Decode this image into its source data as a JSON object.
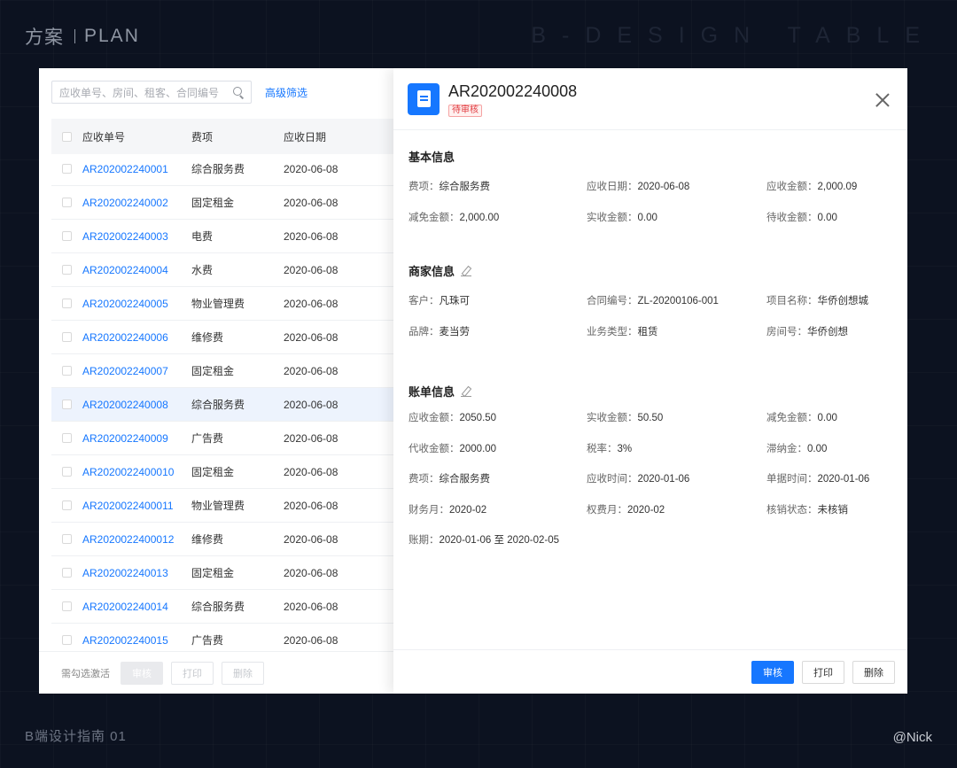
{
  "page": {
    "title_cn": "方案",
    "title_en": "PLAN",
    "brand_right": "B-DESIGN TABLE",
    "footer_left": "B端设计指南 01",
    "footer_right": "@Nick"
  },
  "list": {
    "search_placeholder": "应收单号、房间、租客、合同编号",
    "advanced_filter": "高级筛选",
    "columns": {
      "no": "应收单号",
      "fee": "费项",
      "date": "应收日期"
    },
    "rows": [
      {
        "no": "AR202002240001",
        "fee": "综合服务费",
        "date": "2020-06-08"
      },
      {
        "no": "AR202002240002",
        "fee": "固定租金",
        "date": "2020-06-08"
      },
      {
        "no": "AR202002240003",
        "fee": "电费",
        "date": "2020-06-08"
      },
      {
        "no": "AR202002240004",
        "fee": "水费",
        "date": "2020-06-08"
      },
      {
        "no": "AR202002240005",
        "fee": "物业管理费",
        "date": "2020-06-08"
      },
      {
        "no": "AR202002240006",
        "fee": "维修费",
        "date": "2020-06-08"
      },
      {
        "no": "AR202002240007",
        "fee": "固定租金",
        "date": "2020-06-08"
      },
      {
        "no": "AR202002240008",
        "fee": "综合服务费",
        "date": "2020-06-08"
      },
      {
        "no": "AR202002240009",
        "fee": "广告费",
        "date": "2020-06-08"
      },
      {
        "no": "AR2020022400010",
        "fee": "固定租金",
        "date": "2020-06-08"
      },
      {
        "no": "AR2020022400011",
        "fee": "物业管理费",
        "date": "2020-06-08"
      },
      {
        "no": "AR2020022400012",
        "fee": "维修费",
        "date": "2020-06-08"
      },
      {
        "no": "AR202002240013",
        "fee": "固定租金",
        "date": "2020-06-08"
      },
      {
        "no": "AR202002240014",
        "fee": "综合服务费",
        "date": "2020-06-08"
      },
      {
        "no": "AR202002240015",
        "fee": "广告费",
        "date": "2020-06-08"
      }
    ],
    "selected_index": 7,
    "footer_hint": "需勾选激活",
    "footer_buttons": [
      "审核",
      "打印",
      "删除"
    ]
  },
  "detail": {
    "title": "AR202002240008",
    "status": "待审核",
    "section_basic": "基本信息",
    "section_merchant": "商家信息",
    "section_bill": "账单信息",
    "basic": [
      {
        "label": "费项：",
        "value": "综合服务费"
      },
      {
        "label": "应收日期：",
        "value": "2020-06-08"
      },
      {
        "label": "应收金额：",
        "value": "2,000.09"
      },
      {
        "label": "减免金额：",
        "value": "2,000.00"
      },
      {
        "label": "实收金额：",
        "value": "0.00"
      },
      {
        "label": "待收金额：",
        "value": "0.00"
      }
    ],
    "merchant": [
      {
        "label": "客户：",
        "value": "凡珠可"
      },
      {
        "label": "合同编号：",
        "value": "ZL-20200106-001"
      },
      {
        "label": "项目名称：",
        "value": "华侨创想城"
      },
      {
        "label": "品牌：",
        "value": "麦当劳"
      },
      {
        "label": "业务类型：",
        "value": "租赁"
      },
      {
        "label": "房间号：",
        "value": "华侨创想"
      }
    ],
    "bill": [
      {
        "label": "应收金额：",
        "value": "2050.50"
      },
      {
        "label": "实收金额：",
        "value": "50.50"
      },
      {
        "label": "减免金额：",
        "value": "0.00"
      },
      {
        "label": "代收金额：",
        "value": "2000.00"
      },
      {
        "label": "税率：",
        "value": "3%"
      },
      {
        "label": "滞纳金：",
        "value": "0.00"
      },
      {
        "label": "费项：",
        "value": "综合服务费"
      },
      {
        "label": "应收时间：",
        "value": "2020-01-06"
      },
      {
        "label": "单据时间：",
        "value": "2020-01-06"
      },
      {
        "label": "财务月：",
        "value": "2020-02"
      },
      {
        "label": "权费月：",
        "value": "2020-02"
      },
      {
        "label": "核销状态：",
        "value": "未核销"
      },
      {
        "label": "账期：",
        "value": "2020-01-06 至 2020-02-05"
      }
    ],
    "buttons": {
      "approve": "审核",
      "print": "打印",
      "delete": "删除"
    }
  },
  "colors": {
    "accent": "#1677ff",
    "status_red": "#e0393e",
    "background": "#0c1220"
  }
}
